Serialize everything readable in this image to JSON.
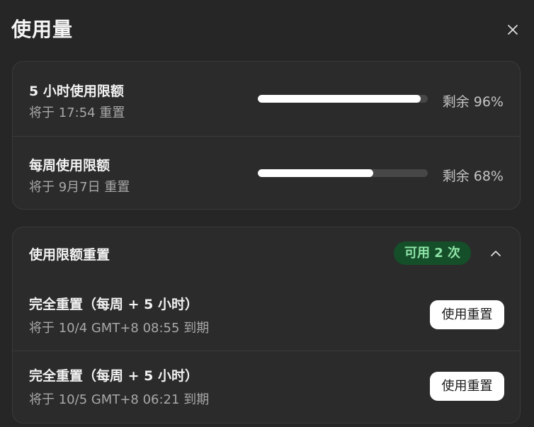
{
  "dialog": {
    "title": "使用量",
    "close_icon": "close-icon"
  },
  "usage_limits": [
    {
      "title": "5 小时使用限额",
      "reset_text": "将于 17:54 重置",
      "remaining_fraction": 0.96,
      "remaining_text": "剩余 96%"
    },
    {
      "title": "每周使用限额",
      "reset_text": "将于 9月7日 重置",
      "remaining_fraction": 0.68,
      "remaining_text": "剩余 68%"
    }
  ],
  "limit_reset": {
    "title": "使用限额重置",
    "badge": "可用 2 次",
    "collapse_icon": "chevron-up-icon",
    "items": [
      {
        "title": "完全重置（每周 + 5 小时）",
        "expiry": "将于 10/4 GMT+8 08:55 到期",
        "button_label": "使用重置"
      },
      {
        "title": "完全重置（每周 + 5 小时）",
        "expiry": "将于 10/5 GMT+8 06:21 到期",
        "button_label": "使用重置"
      }
    ]
  },
  "colors": {
    "background": "#262626",
    "card": "#2b2b2b",
    "badge_bg": "#154f2a",
    "badge_text": "#8ee3a6",
    "bar_fill": "#ffffff",
    "bar_track": "#474747"
  }
}
